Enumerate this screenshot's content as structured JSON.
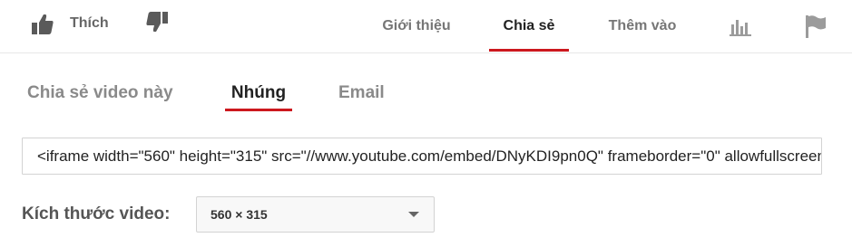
{
  "action_bar": {
    "like_label": "Thích",
    "tabs": [
      {
        "label": "Giới thiệu"
      },
      {
        "label": "Chia sẻ"
      },
      {
        "label": "Thêm vào"
      }
    ],
    "active_tab": "Chia sẻ",
    "icons": {
      "like": "thumbs-up-icon",
      "dislike": "thumbs-down-icon",
      "stats": "bar-chart-icon",
      "report": "flag-icon"
    }
  },
  "share_panel": {
    "subtabs": [
      {
        "label": "Chia sẻ video này"
      },
      {
        "label": "Nhúng"
      },
      {
        "label": "Email"
      }
    ],
    "active_subtab": "Nhúng",
    "embed_code": "<iframe width=\"560\" height=\"315\" src=\"//www.youtube.com/embed/DNyKDI9pn0Q\" frameborder=\"0\" allowfullscreen></iframe>",
    "size_label": "Kích thước video:",
    "size_value": "560 × 315"
  },
  "colors": {
    "accent": "#cc181e",
    "icon_dark": "#5a5a5a",
    "icon_light": "#9b9b9b"
  }
}
